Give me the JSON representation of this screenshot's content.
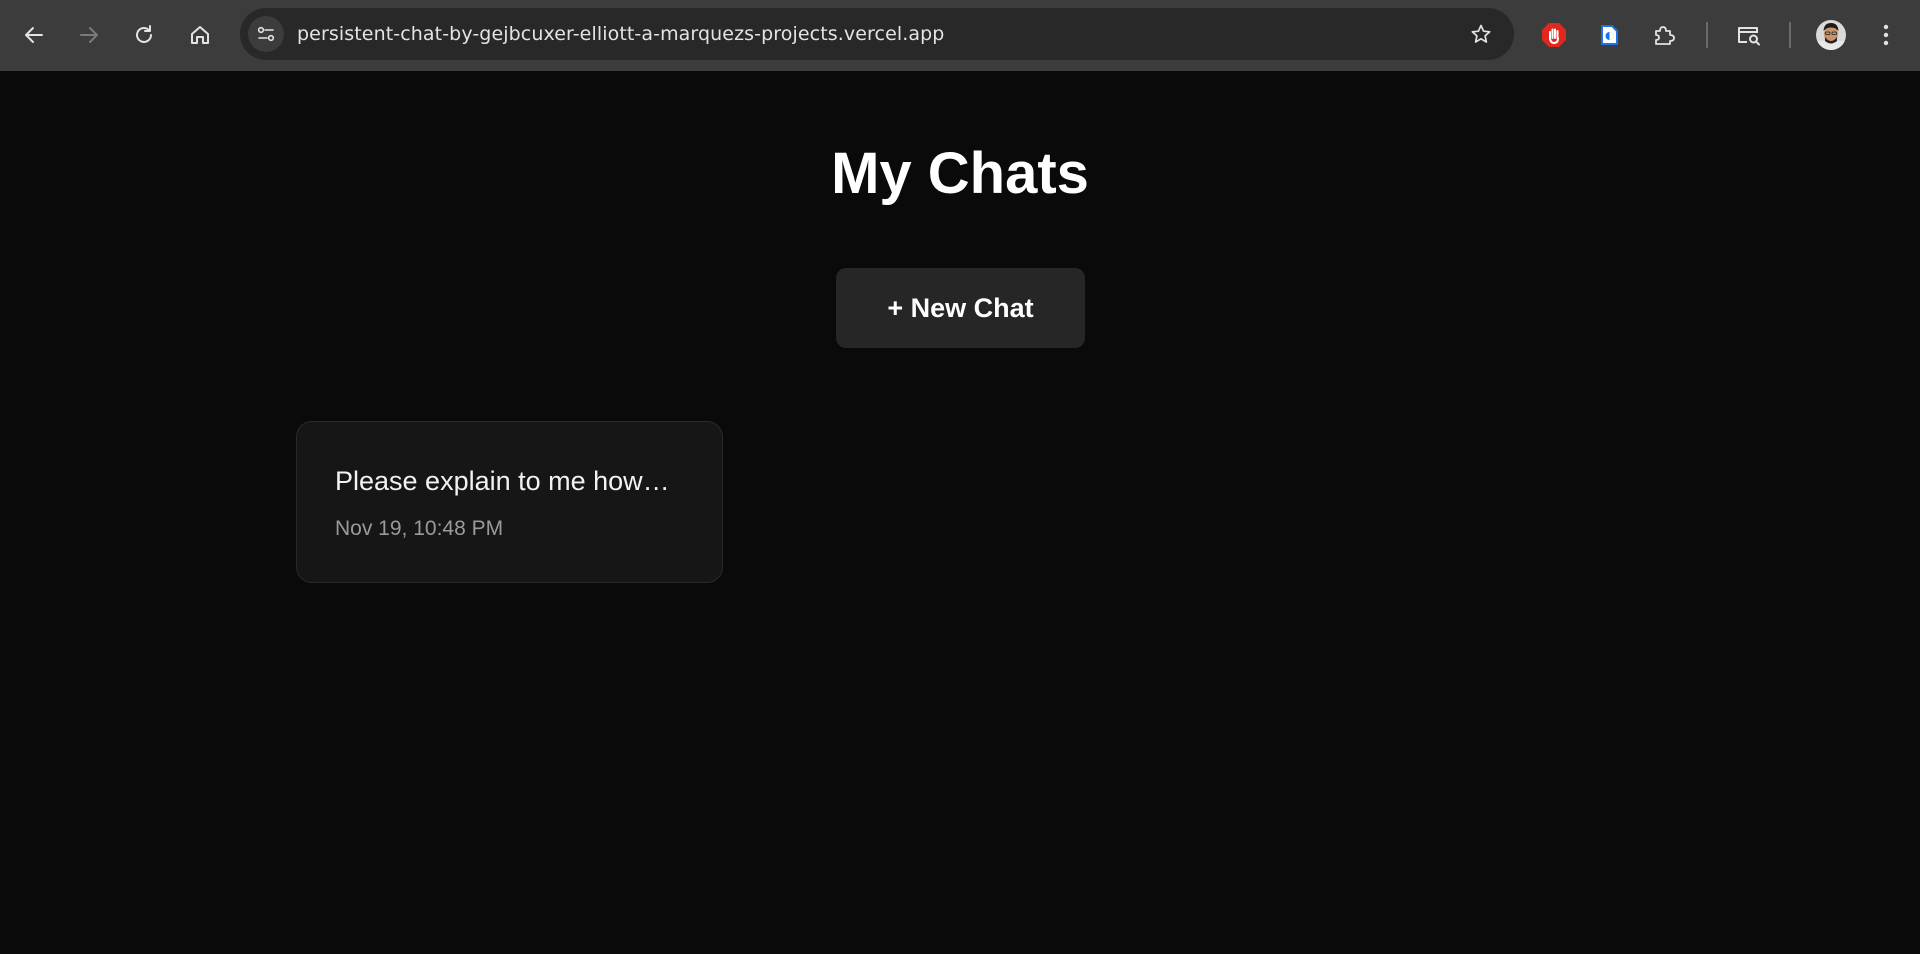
{
  "browser": {
    "url": "persistent-chat-by-gejbcuxer-elliott-a-marquezs-projects.vercel.app",
    "icons": {
      "back": "back-arrow-icon",
      "forward": "forward-arrow-icon",
      "reload": "reload-icon",
      "home": "home-icon",
      "site_info": "site-settings-icon",
      "bookmark": "star-icon",
      "ext1": "stop-hand-extension-icon",
      "ext2": "document-extension-icon",
      "extensions": "puzzle-piece-icon",
      "tab_search": "tab-search-icon",
      "profile": "profile-avatar",
      "menu": "kebab-menu-icon"
    },
    "colors": {
      "toolbar": "#3c3c3c",
      "omnibox": "#282828",
      "ext_red": "#e0281e",
      "ext_blue": "#1a73e8"
    }
  },
  "page": {
    "title": "My Chats",
    "new_chat_label": "+ New Chat",
    "chats": [
      {
        "title": "Please explain to me how…",
        "date": "Nov 19, 10:48 PM"
      }
    ],
    "colors": {
      "background": "#0a0a0a",
      "button": "#262626",
      "card": "#161616",
      "date_text": "#9a9a9a"
    }
  }
}
